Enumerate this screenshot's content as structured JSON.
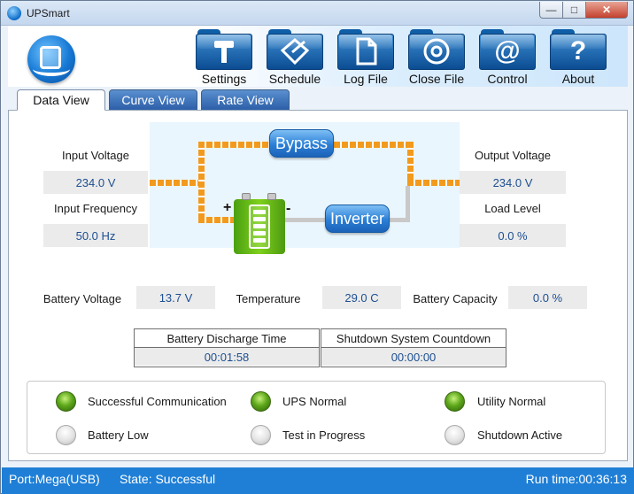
{
  "window": {
    "title": "UPSmart"
  },
  "toolbar": {
    "settings": "Settings",
    "schedule": "Schedule",
    "log_file": "Log File",
    "close_file": "Close File",
    "control": "Control",
    "about": "About"
  },
  "tabs": {
    "data_view": "Data View",
    "curve_view": "Curve View",
    "rate_view": "Rate View"
  },
  "input": {
    "voltage_label": "Input Voltage",
    "voltage_value": "234.0 V",
    "frequency_label": "Input Frequency",
    "frequency_value": "50.0 Hz"
  },
  "output": {
    "voltage_label": "Output Voltage",
    "voltage_value": "234.0 V",
    "load_label": "Load Level",
    "load_value": "0.0 %"
  },
  "diagram": {
    "bypass_label": "Bypass",
    "inverter_label": "Inverter",
    "plus_sign": "+",
    "minus_sign": "-"
  },
  "battery": {
    "voltage_label": "Battery Voltage",
    "voltage_value": "13.7 V",
    "temperature_label": "Temperature",
    "temperature_value": "29.0 C",
    "capacity_label": "Battery Capacity",
    "capacity_value": "0.0 %"
  },
  "countdown": {
    "discharge_label": "Battery Discharge Time",
    "discharge_value": "00:01:58",
    "shutdown_label": "Shutdown System Countdown",
    "shutdown_value": "00:00:00"
  },
  "indicators": {
    "successful_communication": {
      "label": "Successful Communication",
      "on": true
    },
    "ups_normal": {
      "label": "UPS Normal",
      "on": true
    },
    "utility_normal": {
      "label": "Utility Normal",
      "on": true
    },
    "battery_low": {
      "label": "Battery Low",
      "on": false
    },
    "test_in_progress": {
      "label": "Test in Progress",
      "on": false
    },
    "shutdown_active": {
      "label": "Shutdown Active",
      "on": false
    }
  },
  "status": {
    "port": "Port:Mega(USB)",
    "state": "State: Successful",
    "run_time": "Run time:00:36:13"
  },
  "colors": {
    "accent": "#1f7fd6",
    "led_on": "#5ea81b",
    "flow_line": "#f29a1d",
    "value_text": "#1d4f92"
  }
}
